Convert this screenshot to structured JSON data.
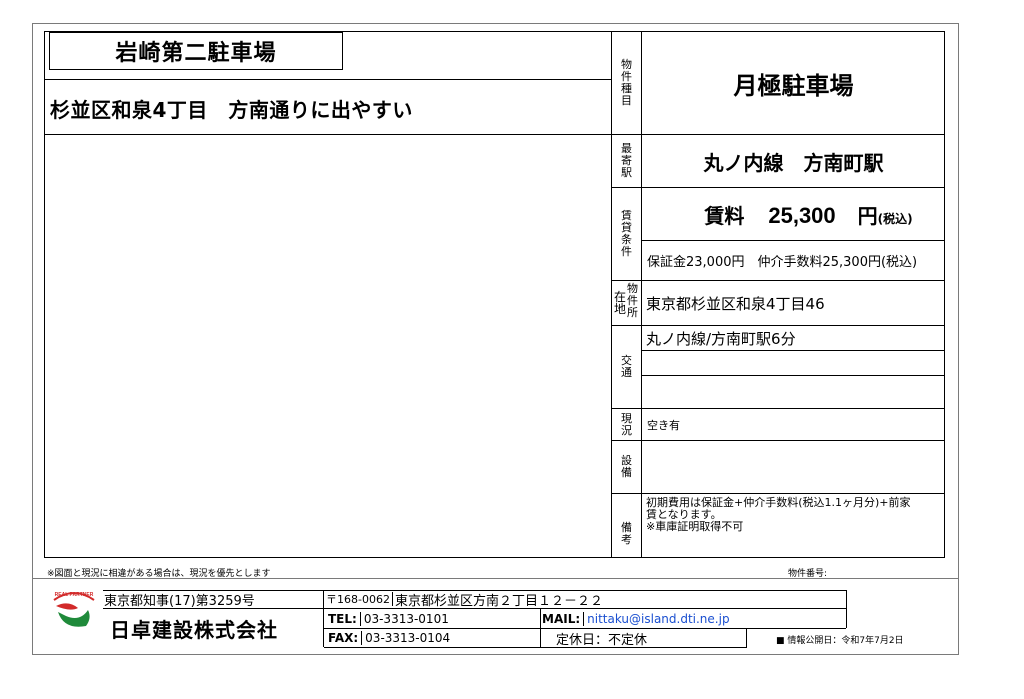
{
  "property": {
    "name": "岩崎第二駐車場",
    "catchphrase": "杉並区和泉4丁目　方南通りに出やすい",
    "type_label": [
      "物",
      "件",
      "種",
      "目"
    ],
    "type_value": "月極駐車場",
    "station_label": [
      "最",
      "寄",
      "駅"
    ],
    "station_value": "丸ノ内線　方南町駅",
    "terms_label": [
      "賃",
      "貸",
      "条",
      "件"
    ],
    "rent_label": "賃料",
    "rent_value": "25,300",
    "rent_unit": "円",
    "rent_tax": "(税込)",
    "fees": "保証金23,000円　仲介手数料25,300円(税込)",
    "address_label_left": [
      "在",
      "地"
    ],
    "address_label_right": [
      "物",
      "件",
      "所"
    ],
    "address_value": "東京都杉並区和泉4丁目46",
    "access_label": [
      "交",
      "通"
    ],
    "access_value": "丸ノ内線/方南町駅6分",
    "status_label": [
      "現",
      "況"
    ],
    "status_value": "空き有",
    "equipment_label": [
      "設",
      "備"
    ],
    "notes_label": [
      "備",
      "考"
    ],
    "notes_line1": "初期費用は保証金+仲介手数料(税込1.1ヶ月分)+前家",
    "notes_line2": "賃となります。",
    "notes_line3": "※車庫証明取得不可"
  },
  "footer": {
    "disclaimer": "※図面と現況に相違がある場合は、現況を優先とします",
    "property_number_label": "物件番号:",
    "license": "東京都知事(17)第3259号",
    "company_name": "日卓建設株式会社",
    "postal": "〒168-0062",
    "address": "東京都杉並区方南２丁目１２－２２",
    "tel_label": "TEL:",
    "tel": "03-3313-0101",
    "fax_label": "FAX:",
    "fax": "03-3313-0104",
    "mail_label": "MAIL:",
    "mail": "nittaku@island.dti.ne.jp",
    "holiday": "定休日：不定休",
    "published": "■ 情報公開日：令和7年7月2日",
    "logo_text": "REAL PARTNER",
    "logo_icon": "leaf-logo-icon"
  },
  "colors": {
    "logo_red": "#d22a2a",
    "logo_green": "#1f8a3a",
    "mail_link": "#1a4fd0"
  }
}
